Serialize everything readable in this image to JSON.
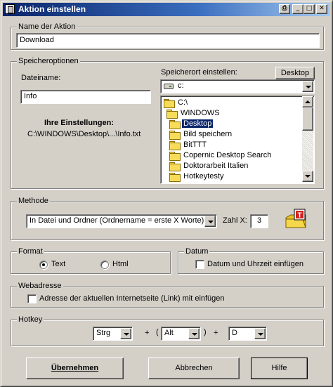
{
  "window": {
    "title": "Aktion einstellen",
    "controls": {
      "print": "⎙",
      "minimize": "_",
      "maximize": "□",
      "close": "✕"
    }
  },
  "name_section": {
    "legend": "Name der Aktion",
    "value": "Download"
  },
  "storage": {
    "legend": "Speicheroptionen",
    "filename_label": "Dateiname:",
    "filename_value": "Info",
    "location_label": "Speicherort einstellen:",
    "desktop_button": "Desktop",
    "drive_value": "c:",
    "settings_heading": "Ihre Einstellungen:",
    "settings_path": "C:\\WINDOWS\\Desktop\\...\\Info.txt",
    "folders": [
      {
        "label": "C:\\",
        "selected": false
      },
      {
        "label": "WINDOWS",
        "selected": false
      },
      {
        "label": "Desktop",
        "selected": true
      },
      {
        "label": "Bild speichern",
        "selected": false
      },
      {
        "label": "BitTTT",
        "selected": false
      },
      {
        "label": "Copernic Desktop Search",
        "selected": false
      },
      {
        "label": "Doktorarbeit Italien",
        "selected": false
      },
      {
        "label": "Hotkeytesty",
        "selected": false
      }
    ]
  },
  "method": {
    "legend": "Methode",
    "value": "In Datei und Ordner (Ordnername = erste X Worte)",
    "count_label": "Zahl X:",
    "count_value": "3",
    "icon": "text-folder-icon"
  },
  "format": {
    "legend": "Format",
    "options": [
      {
        "label": "Text",
        "checked": true
      },
      {
        "label": "Html",
        "checked": false
      }
    ]
  },
  "date": {
    "legend": "Datum",
    "checkbox_label": "Datum und Uhrzeit einfügen",
    "checked": false
  },
  "web": {
    "legend": "Webadresse",
    "checkbox_label": "Adresse der aktuellen Internetseite (Link) mit einfügen",
    "checked": false
  },
  "hotkey": {
    "legend": "Hotkey",
    "modifier1": "Strg",
    "plus1": "+",
    "paren_open": "(",
    "modifier2": "Alt",
    "paren_close": ")",
    "plus2": "+",
    "key": "D"
  },
  "buttons": {
    "apply": "Übernehmen",
    "cancel": "Abbrechen",
    "help": "Hilfe"
  }
}
